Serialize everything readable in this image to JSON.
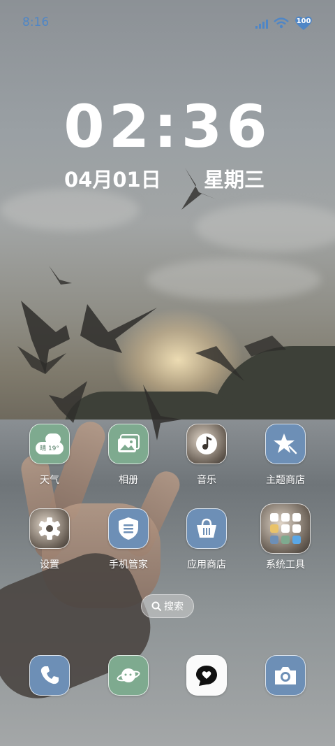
{
  "status_bar": {
    "time": "8:16",
    "battery": "100"
  },
  "clock": {
    "time": "02:36",
    "date": "04月01日",
    "weekday": "星期三"
  },
  "apps": [
    {
      "label": "天气",
      "icon": "weather-icon",
      "weather_text": "晴 19°"
    },
    {
      "label": "相册",
      "icon": "gallery-icon"
    },
    {
      "label": "音乐",
      "icon": "music-icon"
    },
    {
      "label": "主题商店",
      "icon": "theme-store-icon"
    },
    {
      "label": "设置",
      "icon": "settings-icon"
    },
    {
      "label": "手机管家",
      "icon": "phone-manager-icon"
    },
    {
      "label": "应用商店",
      "icon": "app-store-icon"
    },
    {
      "label": "系统工具",
      "icon": "system-tools-folder-icon"
    }
  ],
  "search": {
    "label": "搜索"
  },
  "dock": [
    {
      "name": "phone",
      "icon": "phone-icon"
    },
    {
      "name": "browser",
      "icon": "planet-icon"
    },
    {
      "name": "messages",
      "icon": "chat-heart-icon"
    },
    {
      "name": "camera",
      "icon": "camera-icon"
    }
  ],
  "colors": {
    "accent_status": "#4f86c6",
    "icon_green": "#7eaa8f",
    "icon_blue": "#6d8fb6"
  }
}
